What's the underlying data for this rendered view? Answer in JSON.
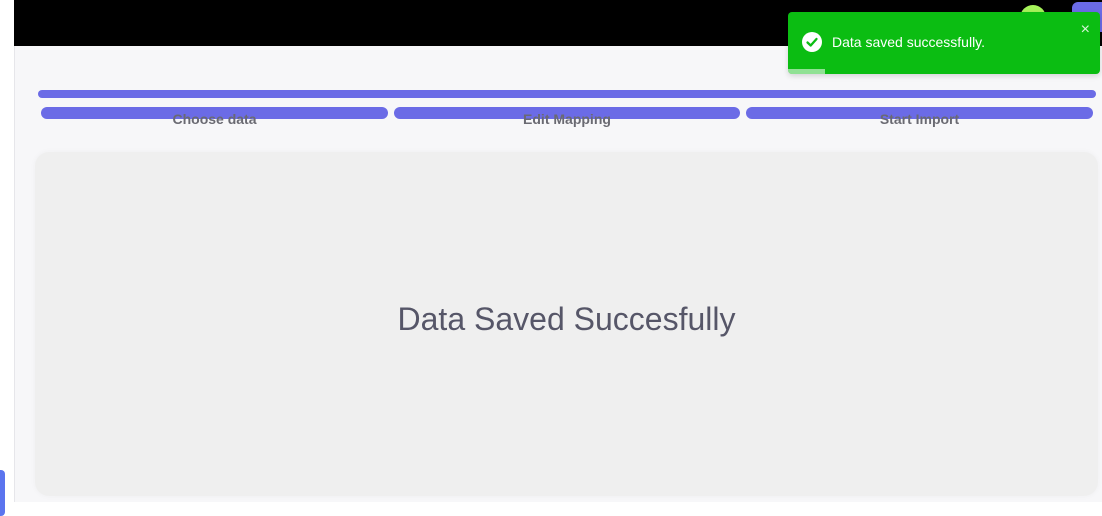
{
  "colors": {
    "accent": "#6b6be6",
    "success": "#0bbd12",
    "panel_bg": "#efefef",
    "status_dot": "#a6f35a"
  },
  "stepper": {
    "steps": [
      {
        "label": "Choose data"
      },
      {
        "label": "Edit Mapping"
      },
      {
        "label": "Start Import"
      }
    ]
  },
  "main": {
    "message": "Data Saved Succesfully"
  },
  "toast": {
    "message": "Data saved successfully.",
    "icon": "check-circle-icon",
    "close_glyph": "×",
    "progress_remaining": 0.12
  }
}
